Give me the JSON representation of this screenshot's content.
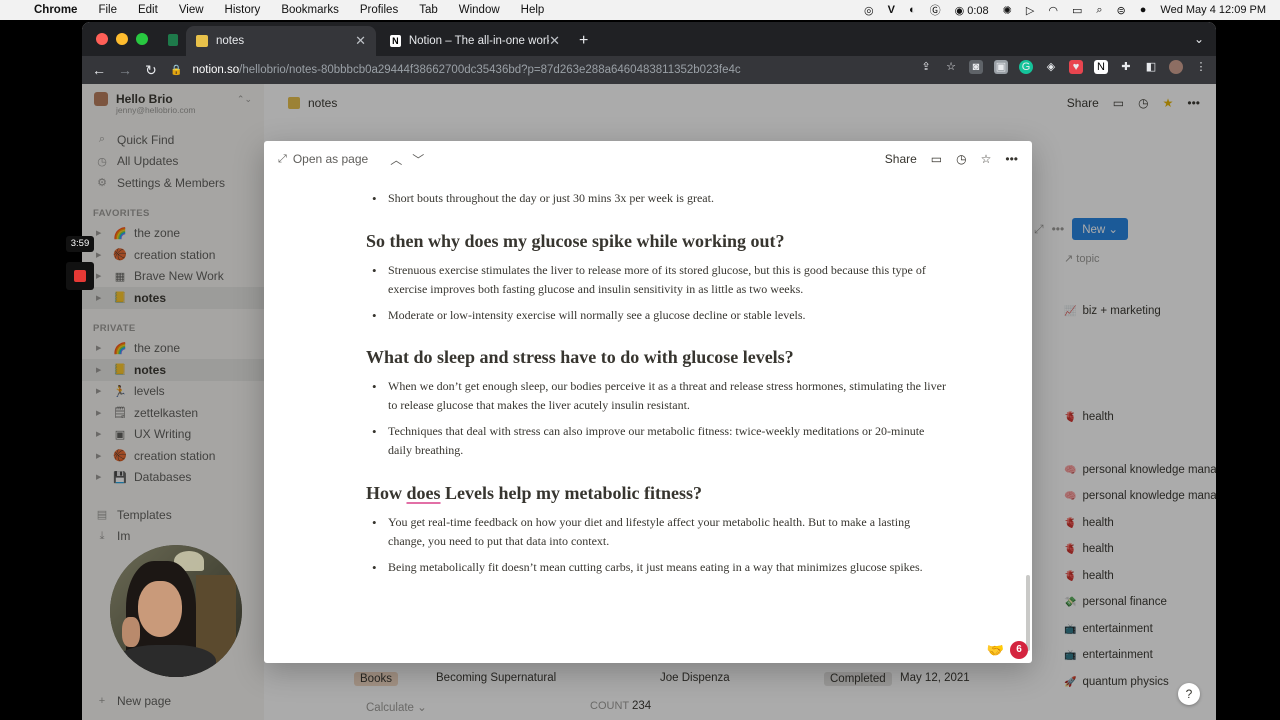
{
  "menubar": {
    "app": "Chrome",
    "items": [
      "File",
      "Edit",
      "View",
      "History",
      "Bookmarks",
      "Profiles",
      "Tab",
      "Window",
      "Help"
    ],
    "clock_small": "0:08",
    "datetime": "Wed May 4  12:09 PM"
  },
  "browser": {
    "tabs": [
      {
        "title": "notes",
        "active": true
      },
      {
        "title": "Notion – The all-in-one worksp",
        "active": false
      }
    ],
    "url_host": "notion.so",
    "url_path": "/hellobrio/notes-80bbbcb0a29444f38662700dc35436bd?p=87d263e288a6460483811352b023fe4c"
  },
  "workspace": {
    "name": "Hello Brio",
    "email": "jenny@hellobrio.com"
  },
  "sidebar": {
    "top": [
      {
        "label": "Quick Find",
        "icon": "search-icon",
        "glyph": "⌕"
      },
      {
        "label": "All Updates",
        "icon": "clock-icon",
        "glyph": "◷"
      },
      {
        "label": "Settings & Members",
        "icon": "gear-icon",
        "glyph": "⚙"
      }
    ],
    "favorites_heading": "FAVORITES",
    "favorites": [
      {
        "label": "the zone",
        "emoji": "🌈"
      },
      {
        "label": "creation station",
        "emoji": "🏀"
      },
      {
        "label": "Brave New Work",
        "emoji": "▦"
      },
      {
        "label": "notes",
        "emoji": "📒",
        "selected": true
      }
    ],
    "private_heading": "PRIVATE",
    "private": [
      {
        "label": "the zone",
        "emoji": "🌈"
      },
      {
        "label": "notes",
        "emoji": "📒",
        "selected": true
      },
      {
        "label": "levels",
        "emoji": "🏃"
      },
      {
        "label": "zettelkasten",
        "emoji": "🗒"
      },
      {
        "label": "UX Writing",
        "emoji": "▣"
      },
      {
        "label": "creation station",
        "emoji": "🏀"
      },
      {
        "label": "Databases",
        "emoji": "💾"
      }
    ],
    "templates": "Templates",
    "import_partial": "Im",
    "new_page": "New page"
  },
  "topbar": {
    "breadcrumb": "notes",
    "share": "Share"
  },
  "database": {
    "new_button": "New",
    "topic_header": "topic",
    "topics": [
      {
        "label": "biz + marketing",
        "emoji": "📈"
      },
      {
        "label": "health",
        "emoji": "🫀"
      },
      {
        "label": "personal knowledge manag",
        "emoji": "🧠"
      },
      {
        "label": "personal knowledge manag",
        "emoji": "🧠"
      },
      {
        "label": "health",
        "emoji": "🫀"
      },
      {
        "label": "health",
        "emoji": "🫀"
      },
      {
        "label": "health",
        "emoji": "🫀"
      },
      {
        "label": "personal finance",
        "emoji": "💸"
      },
      {
        "label": "entertainment",
        "emoji": "📺"
      },
      {
        "label": "entertainment",
        "emoji": "📺"
      },
      {
        "label": "quantum physics",
        "emoji": "🚀"
      }
    ],
    "bottom_row": {
      "type": "Books",
      "title": "Becoming Supernatural",
      "author": "Joe Dispenza",
      "status": "Completed",
      "date": "May 12, 2021"
    },
    "calculate": "Calculate",
    "count_label": "COUNT",
    "count_value": "234"
  },
  "peek": {
    "open_as_page": "Open as page",
    "share": "Share",
    "bullets_top": [
      "Short bouts throughout the day or just 30 mins 3x per week is great."
    ],
    "sections": [
      {
        "heading": "So then why does my glucose spike while working out?",
        "bullets": [
          "Strenuous exercise stimulates the liver to release more of its stored glucose, but this is good because this type of exercise improves both fasting glucose and insulin sensitivity in as little as two weeks.",
          "Moderate or low-intensity exercise will normally see a glucose decline or stable levels."
        ]
      },
      {
        "heading": "What do sleep and stress have to do with glucose levels?",
        "bullets": [
          "When we don’t get enough sleep, our bodies perceive it as a threat and release stress hormones, stimulating the liver to release glucose that makes the liver acutely insulin resistant.",
          "Techniques that deal with stress can also improve our metabolic fitness: twice-weekly meditations or 20-minute daily breathing."
        ]
      },
      {
        "heading_pre": "How ",
        "heading_mark": "does",
        "heading_post": " Levels help my metabolic fitness?",
        "bullets": [
          "You get real-time feedback on how your diet and lifestyle affect your metabolic health. But to make a lasting change, you need to put that data into context.",
          "Being metabolically fit doesn’t mean cutting carbs, it just means eating in a way that minimizes glucose spikes."
        ]
      }
    ],
    "comment_count": "6"
  },
  "recording": {
    "timer": "3:59"
  },
  "help": "?"
}
